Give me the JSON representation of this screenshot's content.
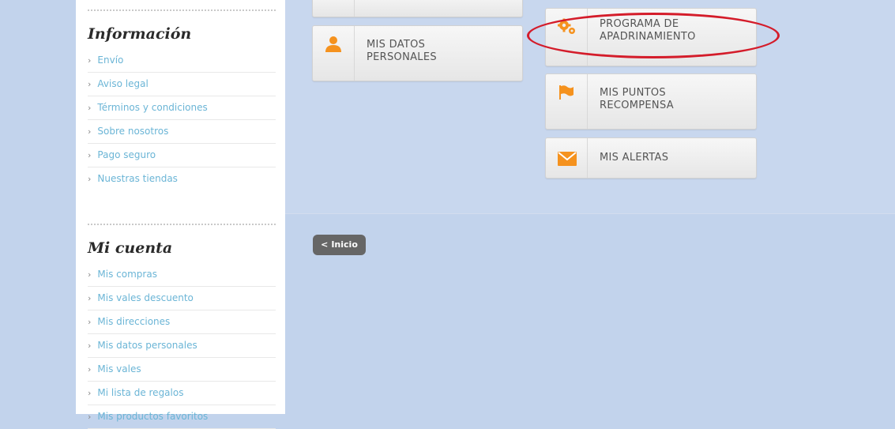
{
  "sidebar": {
    "info": {
      "title": "Información",
      "items": [
        "Envío",
        "Aviso legal",
        "Términos y condiciones",
        "Sobre nosotros",
        "Pago seguro",
        "Nuestras tiendas"
      ]
    },
    "account": {
      "title": "Mi cuenta",
      "items": [
        "Mis compras",
        "Mis vales descuento",
        "Mis direcciones",
        "Mis datos personales",
        "Mis vales",
        "Mi lista de regalos",
        "Mis productos favoritos"
      ]
    }
  },
  "cards": {
    "datos": "MIS DATOS\nPERSONALES",
    "programa": "PROGRAMA DE\nAPADRINAMIENTO",
    "puntos": "MIS PUNTOS\nRECOMPENSA",
    "alertas": "MIS ALERTAS"
  },
  "back_button": {
    "chevron": "<",
    "label": "Inicio"
  },
  "icons": {
    "person": "user-icon",
    "gears": "gears-icon",
    "flag": "flag-icon",
    "mail": "envelope-icon",
    "chevron": "chevron-right-icon"
  },
  "colors": {
    "accent": "#f5921e",
    "link": "#6bb5d6",
    "highlight": "#d41c2a",
    "background": "#c2d3ec"
  }
}
